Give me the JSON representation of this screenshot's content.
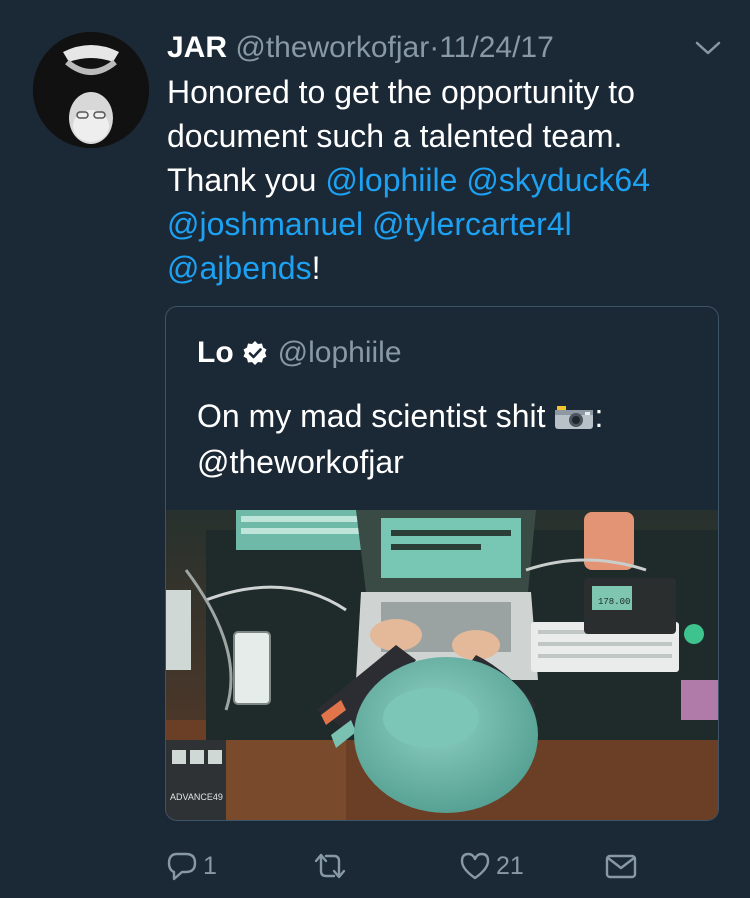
{
  "tweet": {
    "author_name": "JAR",
    "author_handle": "@theworkofjar",
    "separator": "·",
    "date": "11/24/17",
    "text_line1": "Honored to get the opportunity to",
    "text_line2": "document such a talented team.",
    "text_thanks": "Thank you ",
    "mentions": [
      "@lophiile",
      "@skyduck64",
      "@joshmanuel",
      "@tylercarter4l",
      "@ajbends"
    ],
    "text_end": "!"
  },
  "quoted_tweet": {
    "author_name": "Lo",
    "author_handle": "@lophiile",
    "text": "On my mad scientist shit",
    "emoji_icon": "camera-with-flash-icon",
    "text_suffix": ":",
    "mention": "@theworkofjar",
    "media_text": "ADVANCE49",
    "display_readout": "178.00"
  },
  "actions": {
    "reply_count": "1",
    "retweet_count": "",
    "like_count": "21"
  },
  "colors": {
    "background": "#1b2836",
    "mention": "#1da1f2",
    "secondary_text": "#8899a6",
    "border": "#3d5466"
  }
}
